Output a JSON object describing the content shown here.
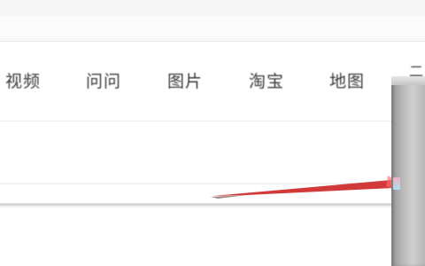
{
  "top_bar": {
    "bg_color": "#f6f6f6"
  },
  "nav": {
    "items": [
      {
        "label": "视频"
      },
      {
        "label": "问问"
      },
      {
        "label": "图片"
      },
      {
        "label": "淘宝"
      },
      {
        "label": "地图"
      }
    ],
    "partial_right_label": "二"
  },
  "search": {
    "value": "",
    "placeholder": ""
  },
  "colors": {
    "accent_red": "#d23a3a",
    "text": "#3a3a3a",
    "border_gray": "#d8d8d8"
  },
  "icons": {
    "swoosh": "red-swoosh-logo",
    "handle": "scrollbar-handle"
  }
}
